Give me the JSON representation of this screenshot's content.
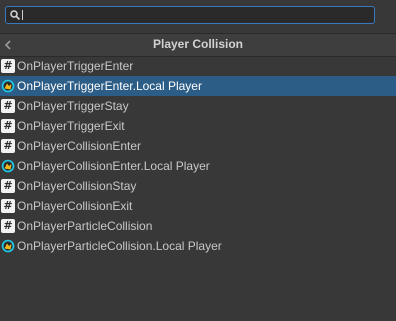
{
  "search": {
    "value": "",
    "placeholder": ""
  },
  "header": {
    "title": "Player Collision"
  },
  "items": [
    {
      "label": "OnPlayerTriggerEnter",
      "icon": "hash-icon",
      "selected": false
    },
    {
      "label": "OnPlayerTriggerEnter.Local Player",
      "icon": "local-player-event-icon",
      "selected": true
    },
    {
      "label": "OnPlayerTriggerStay",
      "icon": "hash-icon",
      "selected": false
    },
    {
      "label": "OnPlayerTriggerExit",
      "icon": "hash-icon",
      "selected": false
    },
    {
      "label": "OnPlayerCollisionEnter",
      "icon": "hash-icon",
      "selected": false
    },
    {
      "label": "OnPlayerCollisionEnter.Local Player",
      "icon": "local-player-event-icon",
      "selected": false
    },
    {
      "label": "OnPlayerCollisionStay",
      "icon": "hash-icon",
      "selected": false
    },
    {
      "label": "OnPlayerCollisionExit",
      "icon": "hash-icon",
      "selected": false
    },
    {
      "label": "OnPlayerParticleCollision",
      "icon": "hash-icon",
      "selected": false
    },
    {
      "label": "OnPlayerParticleCollision.Local Player",
      "icon": "local-player-event-icon",
      "selected": false
    }
  ],
  "colors": {
    "background": "#383838",
    "selection": "#2c5d87",
    "search_border": "#3a79bb",
    "local_player_icon_ring": "#1ec8e6",
    "local_player_icon_body": "#f0b81e"
  }
}
